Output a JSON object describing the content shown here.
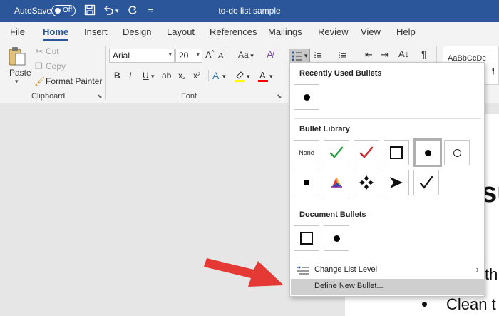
{
  "titlebar": {
    "autosave_label": "AutoSave",
    "autosave_state": "Off",
    "doc_title": "to-do list sample",
    "icons": [
      "save-icon",
      "undo-icon",
      "redo-icon",
      "customize-qat-icon"
    ]
  },
  "tabs": [
    {
      "label": "File"
    },
    {
      "label": "Home",
      "active": true
    },
    {
      "label": "Insert"
    },
    {
      "label": "Design"
    },
    {
      "label": "Layout"
    },
    {
      "label": "References"
    },
    {
      "label": "Mailings"
    },
    {
      "label": "Review"
    },
    {
      "label": "View"
    },
    {
      "label": "Help"
    }
  ],
  "ribbon": {
    "clipboard": {
      "paste_label": "Paste",
      "cut_label": "Cut",
      "copy_label": "Copy",
      "format_painter_label": "Format Painter",
      "group_label": "Clipboard"
    },
    "font": {
      "font_name": "Arial",
      "font_size": "20",
      "change_case_label": "Aa",
      "group_label": "Font",
      "buttons": [
        "B",
        "I",
        "U",
        "ab",
        "x₂",
        "x²"
      ],
      "highlight_color": "#ffff00",
      "font_color": "#ff0000"
    },
    "styles": {
      "preview_text": "AaBbCcDc",
      "normal_mark": "¶"
    }
  },
  "panel": {
    "recent_title": "Recently Used Bullets",
    "library_title": "Bullet Library",
    "none_label": "None",
    "document_title": "Document Bullets",
    "change_level_label": "Change List Level",
    "define_new_label": "Define New Bullet...",
    "library_icons": [
      "none",
      "green-check-icon",
      "red-check-icon",
      "hollow-square-icon",
      "filled-circle-icon",
      "hollow-circle-icon",
      "filled-square-icon",
      "colorful-star-icon",
      "four-diamond-icon",
      "arrowhead-icon",
      "check-mark-icon"
    ]
  },
  "document": {
    "heading_fragment": "su",
    "line1_fragment": "th",
    "line2_fragment": "Clean t"
  },
  "colors": {
    "title_bar": "#2b579a",
    "arrow": "#e53935",
    "check_green": "#2e9e47",
    "check_red": "#c62828"
  }
}
